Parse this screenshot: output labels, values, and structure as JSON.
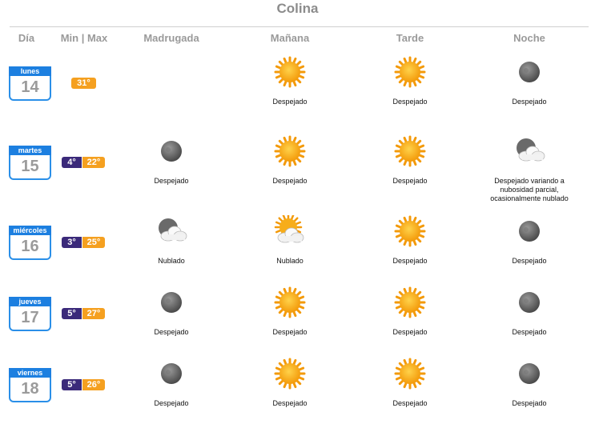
{
  "title": "Colina",
  "headers": [
    "Día",
    "Min | Max",
    "Madrugada",
    "Mañana",
    "Tarde",
    "Noche"
  ],
  "days": [
    {
      "name": "lunes",
      "num": "14",
      "min": "",
      "max": "31°",
      "periods": [
        null,
        {
          "icon": "sun-icon",
          "text": "Despejado"
        },
        {
          "icon": "sun-icon",
          "text": "Despejado"
        },
        {
          "icon": "moon-icon",
          "text": "Despejado"
        }
      ]
    },
    {
      "name": "martes",
      "num": "15",
      "min": "4°",
      "max": "22°",
      "periods": [
        {
          "icon": "moon-icon",
          "text": "Despejado"
        },
        {
          "icon": "sun-icon",
          "text": "Despejado"
        },
        {
          "icon": "sun-icon",
          "text": "Despejado"
        },
        {
          "icon": "moon-cloud-icon",
          "text": "Despejado variando a nubosidad parcial, ocasionalmente nublado"
        }
      ]
    },
    {
      "name": "miércoles",
      "num": "16",
      "min": "3°",
      "max": "25°",
      "periods": [
        {
          "icon": "moon-cloud-icon",
          "text": "Nublado"
        },
        {
          "icon": "sun-cloud-icon",
          "text": "Nublado"
        },
        {
          "icon": "sun-icon",
          "text": "Despejado"
        },
        {
          "icon": "moon-icon",
          "text": "Despejado"
        }
      ]
    },
    {
      "name": "jueves",
      "num": "17",
      "min": "5°",
      "max": "27°",
      "periods": [
        {
          "icon": "moon-icon",
          "text": "Despejado"
        },
        {
          "icon": "sun-icon",
          "text": "Despejado"
        },
        {
          "icon": "sun-icon",
          "text": "Despejado"
        },
        {
          "icon": "moon-icon",
          "text": "Despejado"
        }
      ]
    },
    {
      "name": "viernes",
      "num": "18",
      "min": "5°",
      "max": "26°",
      "periods": [
        {
          "icon": "moon-icon",
          "text": "Despejado"
        },
        {
          "icon": "sun-icon",
          "text": "Despejado"
        },
        {
          "icon": "sun-icon",
          "text": "Despejado"
        },
        {
          "icon": "moon-icon",
          "text": "Despejado"
        }
      ]
    }
  ]
}
